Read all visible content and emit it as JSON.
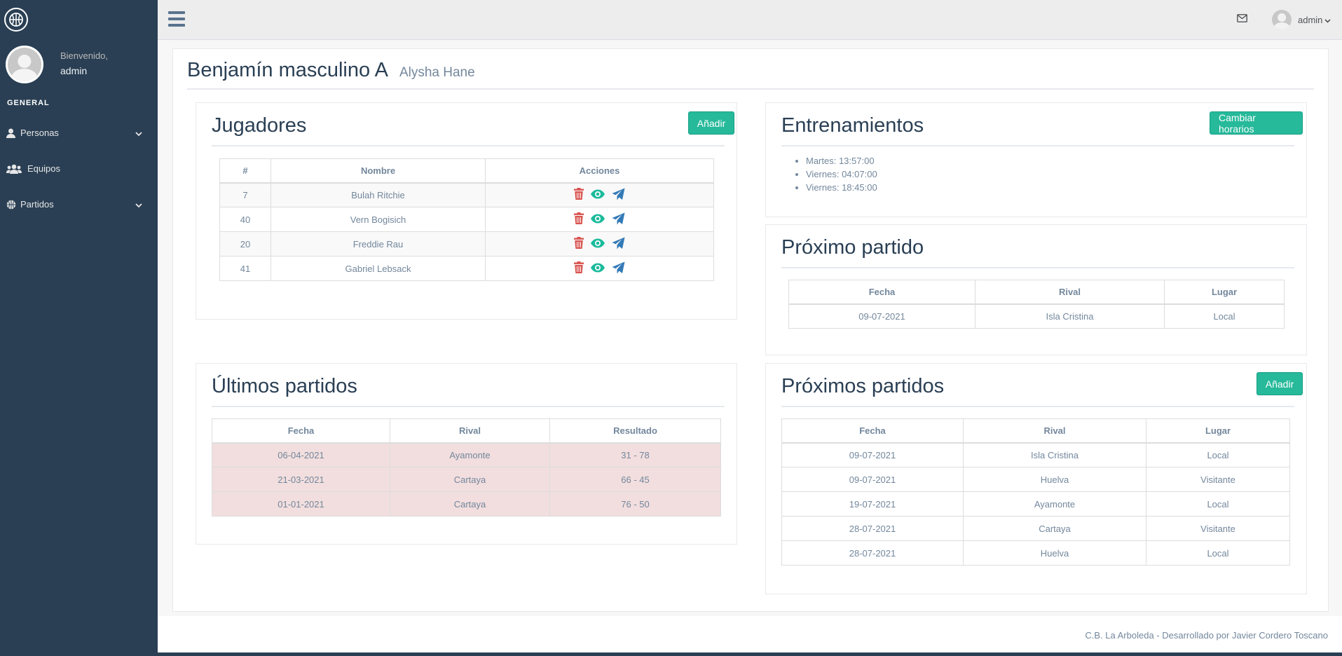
{
  "sidebar": {
    "welcome": "Bienvenido,",
    "username": "admin",
    "section": "GENERAL",
    "items": [
      {
        "label": "Personas",
        "icon": "user-icon",
        "has_submenu": true
      },
      {
        "label": "Equipos",
        "icon": "users-icon",
        "has_submenu": false
      },
      {
        "label": "Partidos",
        "icon": "basketball-icon",
        "has_submenu": true
      }
    ]
  },
  "topnav": {
    "user": "admin"
  },
  "page": {
    "title": "Benjamín masculino A",
    "subtitle": "Alysha Hane"
  },
  "jugadores": {
    "title": "Jugadores",
    "add_label": "Añadir",
    "headers": [
      "#",
      "Nombre",
      "Acciones"
    ],
    "rows": [
      {
        "num": "7",
        "name": "Bulah Ritchie"
      },
      {
        "num": "40",
        "name": "Vern Bogisich"
      },
      {
        "num": "20",
        "name": "Freddie Rau"
      },
      {
        "num": "41",
        "name": "Gabriel Lebsack"
      }
    ]
  },
  "entrenamientos": {
    "title": "Entrenamientos",
    "button_label": "Cambiar horarios",
    "items": [
      "Martes: 13:57:00",
      "Viernes: 04:07:00",
      "Viernes: 18:45:00"
    ]
  },
  "proximo": {
    "title": "Próximo partido",
    "headers": [
      "Fecha",
      "Rival",
      "Lugar"
    ],
    "rows": [
      [
        "09-07-2021",
        "Isla Cristina",
        "Local"
      ]
    ]
  },
  "ultimos": {
    "title": "Últimos partidos",
    "headers": [
      "Fecha",
      "Rival",
      "Resultado"
    ],
    "rows": [
      [
        "06-04-2021",
        "Ayamonte",
        "31 - 78"
      ],
      [
        "21-03-2021",
        "Cartaya",
        "66 - 45"
      ],
      [
        "01-01-2021",
        "Cartaya",
        "76 - 50"
      ]
    ]
  },
  "proximos": {
    "title": "Próximos partidos",
    "add_label": "Añadir",
    "headers": [
      "Fecha",
      "Rival",
      "Lugar"
    ],
    "rows": [
      [
        "09-07-2021",
        "Isla Cristina",
        "Local"
      ],
      [
        "09-07-2021",
        "Huelva",
        "Visitante"
      ],
      [
        "19-07-2021",
        "Ayamonte",
        "Local"
      ],
      [
        "28-07-2021",
        "Cartaya",
        "Visitante"
      ],
      [
        "28-07-2021",
        "Huelva",
        "Local"
      ]
    ]
  },
  "footer": {
    "text": "C.B. La Arboleda - Desarrollado por Javier Cordero Toscano"
  },
  "colors": {
    "sidebar_bg": "#2A3F54",
    "accent_green": "#26B99A",
    "delete_red": "#D9534F",
    "view_teal": "#1ABB9C",
    "send_blue": "#337AB7",
    "loss_row": "#F2DEDE"
  }
}
